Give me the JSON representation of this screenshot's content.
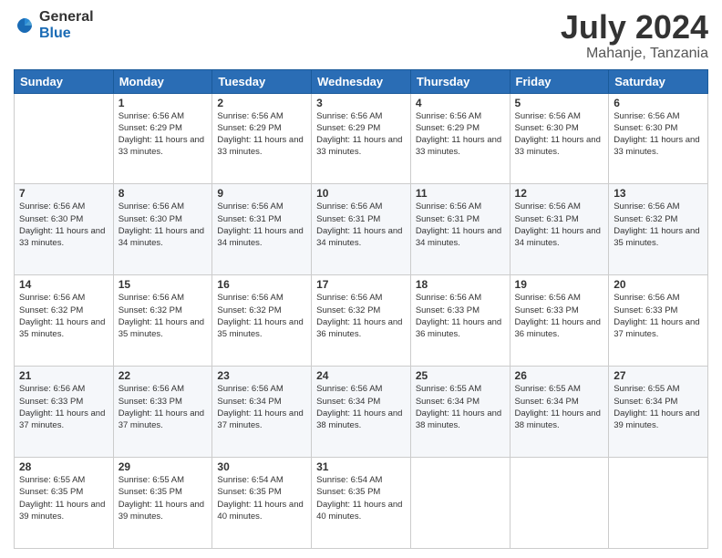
{
  "logo": {
    "text_general": "General",
    "text_blue": "Blue"
  },
  "title": "July 2024",
  "location": "Mahanje, Tanzania",
  "days_of_week": [
    "Sunday",
    "Monday",
    "Tuesday",
    "Wednesday",
    "Thursday",
    "Friday",
    "Saturday"
  ],
  "weeks": [
    [
      {
        "day": "",
        "sunrise": "",
        "sunset": "",
        "daylight": ""
      },
      {
        "day": "1",
        "sunrise": "Sunrise: 6:56 AM",
        "sunset": "Sunset: 6:29 PM",
        "daylight": "Daylight: 11 hours and 33 minutes."
      },
      {
        "day": "2",
        "sunrise": "Sunrise: 6:56 AM",
        "sunset": "Sunset: 6:29 PM",
        "daylight": "Daylight: 11 hours and 33 minutes."
      },
      {
        "day": "3",
        "sunrise": "Sunrise: 6:56 AM",
        "sunset": "Sunset: 6:29 PM",
        "daylight": "Daylight: 11 hours and 33 minutes."
      },
      {
        "day": "4",
        "sunrise": "Sunrise: 6:56 AM",
        "sunset": "Sunset: 6:29 PM",
        "daylight": "Daylight: 11 hours and 33 minutes."
      },
      {
        "day": "5",
        "sunrise": "Sunrise: 6:56 AM",
        "sunset": "Sunset: 6:30 PM",
        "daylight": "Daylight: 11 hours and 33 minutes."
      },
      {
        "day": "6",
        "sunrise": "Sunrise: 6:56 AM",
        "sunset": "Sunset: 6:30 PM",
        "daylight": "Daylight: 11 hours and 33 minutes."
      }
    ],
    [
      {
        "day": "7",
        "sunrise": "Sunrise: 6:56 AM",
        "sunset": "Sunset: 6:30 PM",
        "daylight": "Daylight: 11 hours and 33 minutes."
      },
      {
        "day": "8",
        "sunrise": "Sunrise: 6:56 AM",
        "sunset": "Sunset: 6:30 PM",
        "daylight": "Daylight: 11 hours and 34 minutes."
      },
      {
        "day": "9",
        "sunrise": "Sunrise: 6:56 AM",
        "sunset": "Sunset: 6:31 PM",
        "daylight": "Daylight: 11 hours and 34 minutes."
      },
      {
        "day": "10",
        "sunrise": "Sunrise: 6:56 AM",
        "sunset": "Sunset: 6:31 PM",
        "daylight": "Daylight: 11 hours and 34 minutes."
      },
      {
        "day": "11",
        "sunrise": "Sunrise: 6:56 AM",
        "sunset": "Sunset: 6:31 PM",
        "daylight": "Daylight: 11 hours and 34 minutes."
      },
      {
        "day": "12",
        "sunrise": "Sunrise: 6:56 AM",
        "sunset": "Sunset: 6:31 PM",
        "daylight": "Daylight: 11 hours and 34 minutes."
      },
      {
        "day": "13",
        "sunrise": "Sunrise: 6:56 AM",
        "sunset": "Sunset: 6:32 PM",
        "daylight": "Daylight: 11 hours and 35 minutes."
      }
    ],
    [
      {
        "day": "14",
        "sunrise": "Sunrise: 6:56 AM",
        "sunset": "Sunset: 6:32 PM",
        "daylight": "Daylight: 11 hours and 35 minutes."
      },
      {
        "day": "15",
        "sunrise": "Sunrise: 6:56 AM",
        "sunset": "Sunset: 6:32 PM",
        "daylight": "Daylight: 11 hours and 35 minutes."
      },
      {
        "day": "16",
        "sunrise": "Sunrise: 6:56 AM",
        "sunset": "Sunset: 6:32 PM",
        "daylight": "Daylight: 11 hours and 35 minutes."
      },
      {
        "day": "17",
        "sunrise": "Sunrise: 6:56 AM",
        "sunset": "Sunset: 6:32 PM",
        "daylight": "Daylight: 11 hours and 36 minutes."
      },
      {
        "day": "18",
        "sunrise": "Sunrise: 6:56 AM",
        "sunset": "Sunset: 6:33 PM",
        "daylight": "Daylight: 11 hours and 36 minutes."
      },
      {
        "day": "19",
        "sunrise": "Sunrise: 6:56 AM",
        "sunset": "Sunset: 6:33 PM",
        "daylight": "Daylight: 11 hours and 36 minutes."
      },
      {
        "day": "20",
        "sunrise": "Sunrise: 6:56 AM",
        "sunset": "Sunset: 6:33 PM",
        "daylight": "Daylight: 11 hours and 37 minutes."
      }
    ],
    [
      {
        "day": "21",
        "sunrise": "Sunrise: 6:56 AM",
        "sunset": "Sunset: 6:33 PM",
        "daylight": "Daylight: 11 hours and 37 minutes."
      },
      {
        "day": "22",
        "sunrise": "Sunrise: 6:56 AM",
        "sunset": "Sunset: 6:33 PM",
        "daylight": "Daylight: 11 hours and 37 minutes."
      },
      {
        "day": "23",
        "sunrise": "Sunrise: 6:56 AM",
        "sunset": "Sunset: 6:34 PM",
        "daylight": "Daylight: 11 hours and 37 minutes."
      },
      {
        "day": "24",
        "sunrise": "Sunrise: 6:56 AM",
        "sunset": "Sunset: 6:34 PM",
        "daylight": "Daylight: 11 hours and 38 minutes."
      },
      {
        "day": "25",
        "sunrise": "Sunrise: 6:55 AM",
        "sunset": "Sunset: 6:34 PM",
        "daylight": "Daylight: 11 hours and 38 minutes."
      },
      {
        "day": "26",
        "sunrise": "Sunrise: 6:55 AM",
        "sunset": "Sunset: 6:34 PM",
        "daylight": "Daylight: 11 hours and 38 minutes."
      },
      {
        "day": "27",
        "sunrise": "Sunrise: 6:55 AM",
        "sunset": "Sunset: 6:34 PM",
        "daylight": "Daylight: 11 hours and 39 minutes."
      }
    ],
    [
      {
        "day": "28",
        "sunrise": "Sunrise: 6:55 AM",
        "sunset": "Sunset: 6:35 PM",
        "daylight": "Daylight: 11 hours and 39 minutes."
      },
      {
        "day": "29",
        "sunrise": "Sunrise: 6:55 AM",
        "sunset": "Sunset: 6:35 PM",
        "daylight": "Daylight: 11 hours and 39 minutes."
      },
      {
        "day": "30",
        "sunrise": "Sunrise: 6:54 AM",
        "sunset": "Sunset: 6:35 PM",
        "daylight": "Daylight: 11 hours and 40 minutes."
      },
      {
        "day": "31",
        "sunrise": "Sunrise: 6:54 AM",
        "sunset": "Sunset: 6:35 PM",
        "daylight": "Daylight: 11 hours and 40 minutes."
      },
      {
        "day": "",
        "sunrise": "",
        "sunset": "",
        "daylight": ""
      },
      {
        "day": "",
        "sunrise": "",
        "sunset": "",
        "daylight": ""
      },
      {
        "day": "",
        "sunrise": "",
        "sunset": "",
        "daylight": ""
      }
    ]
  ]
}
